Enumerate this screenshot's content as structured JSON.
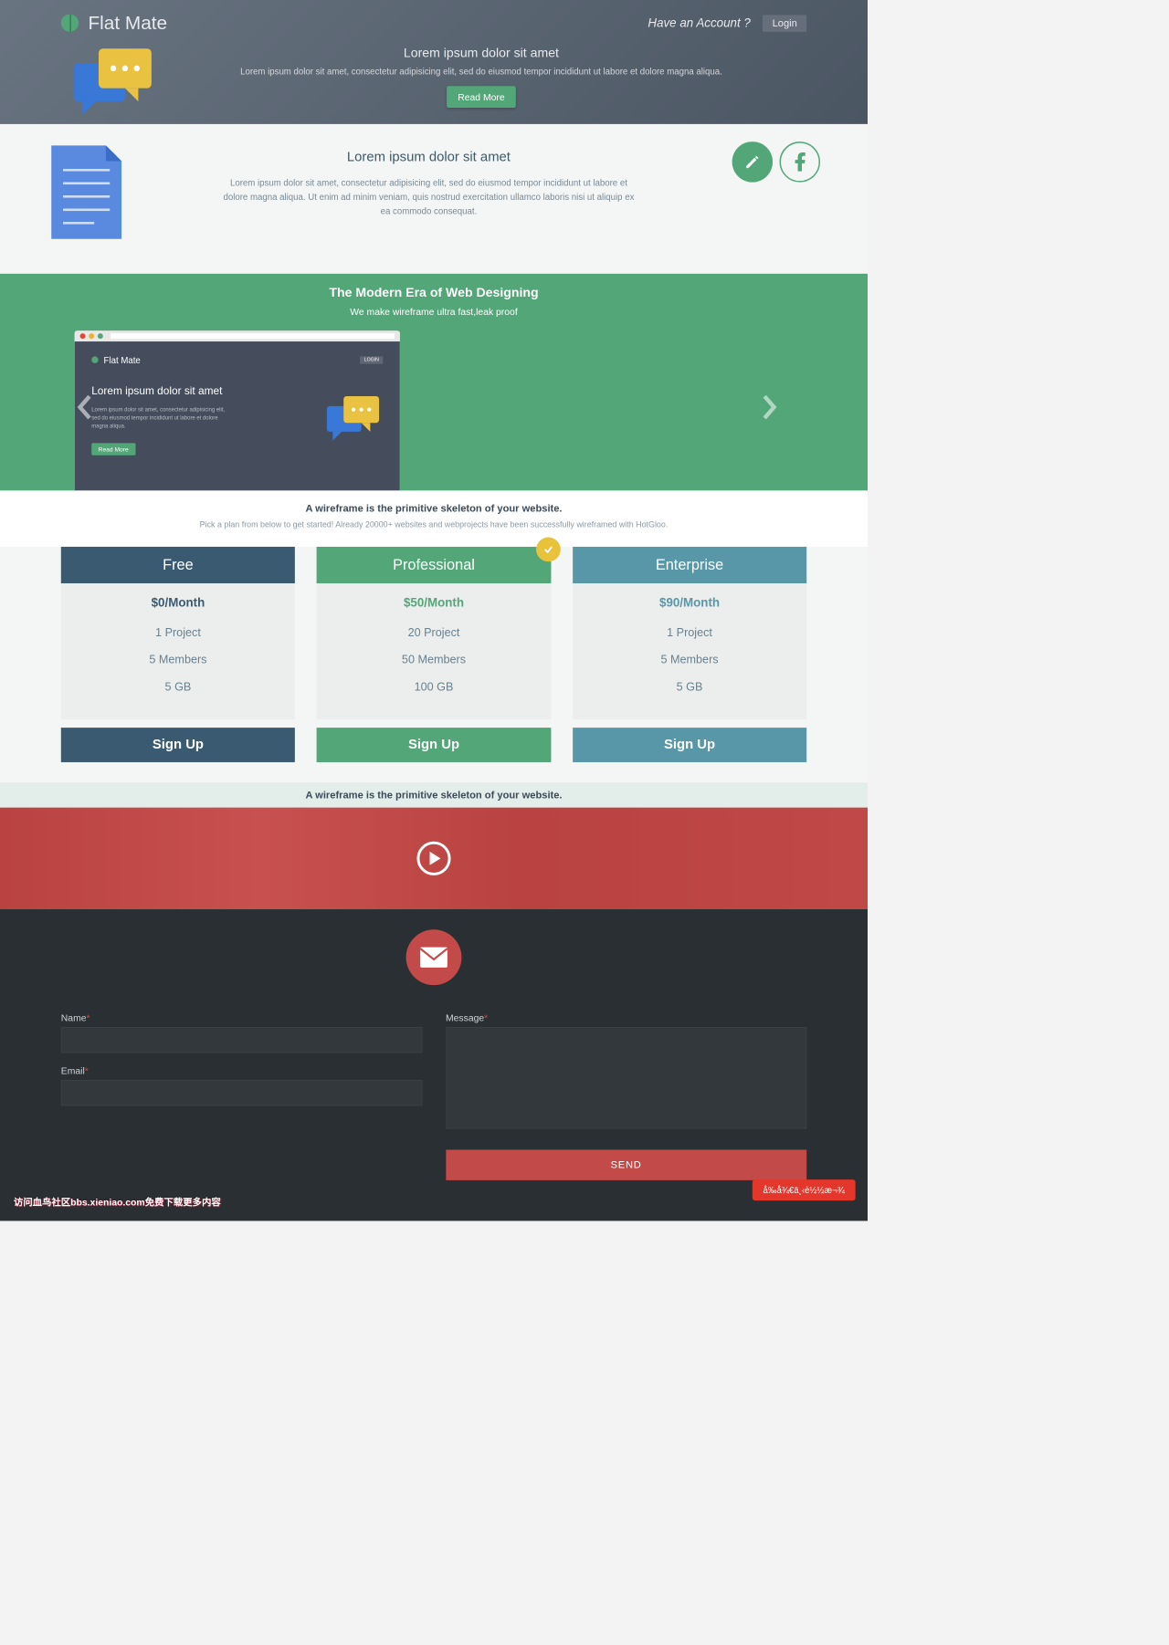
{
  "nav": {
    "brand": "Flat Mate",
    "account_prompt": "Have an Account ?",
    "login": "Login"
  },
  "hero": {
    "title": "Lorem ipsum dolor sit amet",
    "subtitle": "Lorem ipsum dolor sit amet, consectetur adipisicing elit, sed do eiusmod tempor incididunt ut labore et dolore magna aliqua.",
    "cta": "Read More"
  },
  "mid": {
    "title": "Lorem ipsum dolor sit amet",
    "body": "Lorem ipsum dolor sit amet, consectetur adipisicing elit, sed do eiusmod tempor incididunt ut labore et dolore magna aliqua. Ut enim ad minim veniam, quis nostrud exercitation ullamco laboris nisi ut aliquip ex ea commodo consequat."
  },
  "modern": {
    "title": "The Modern Era of Web Designing",
    "sub": "We make wireframe ultra fast,leak proof"
  },
  "carousel": {
    "brand": "Flat Mate",
    "login": "LOGIN",
    "title": "Lorem ipsum dolor sit amet",
    "body": "Lorem ipsum dolor sit amet, consectetur adipisicing elit, sed do eiusmod tempor incididunt ut labore et dolore magna aliqua.",
    "cta": "Read More"
  },
  "plans_head": {
    "title": "A wireframe is the primitive skeleton of your website.",
    "sub": "Pick a plan from below to get started! Already 20000+ websites and webprojects have been successfully wireframed with HotGloo."
  },
  "plans": [
    {
      "name": "Free",
      "price": "$0/Month",
      "f1": "1 Project",
      "f2": "5 Members",
      "f3": "5 GB",
      "cta": "Sign Up"
    },
    {
      "name": "Professional",
      "price": "$50/Month",
      "f1": "20 Project",
      "f2": "50 Members",
      "f3": "100 GB",
      "cta": "Sign Up"
    },
    {
      "name": "Enterprise",
      "price": "$90/Month",
      "f1": "1 Project",
      "f2": "5 Members",
      "f3": "5 GB",
      "cta": "Sign Up"
    }
  ],
  "strip": "A wireframe is the primitive skeleton of your website.",
  "contact": {
    "name": "Name",
    "email": "Email",
    "message": "Message",
    "send": "SEND",
    "req": "*"
  },
  "float_badge": "å‰å¾€ä¸‹è½½æ¬¾",
  "watermark": "访问血鸟社区bbs.xieniao.com免费下载更多内容"
}
